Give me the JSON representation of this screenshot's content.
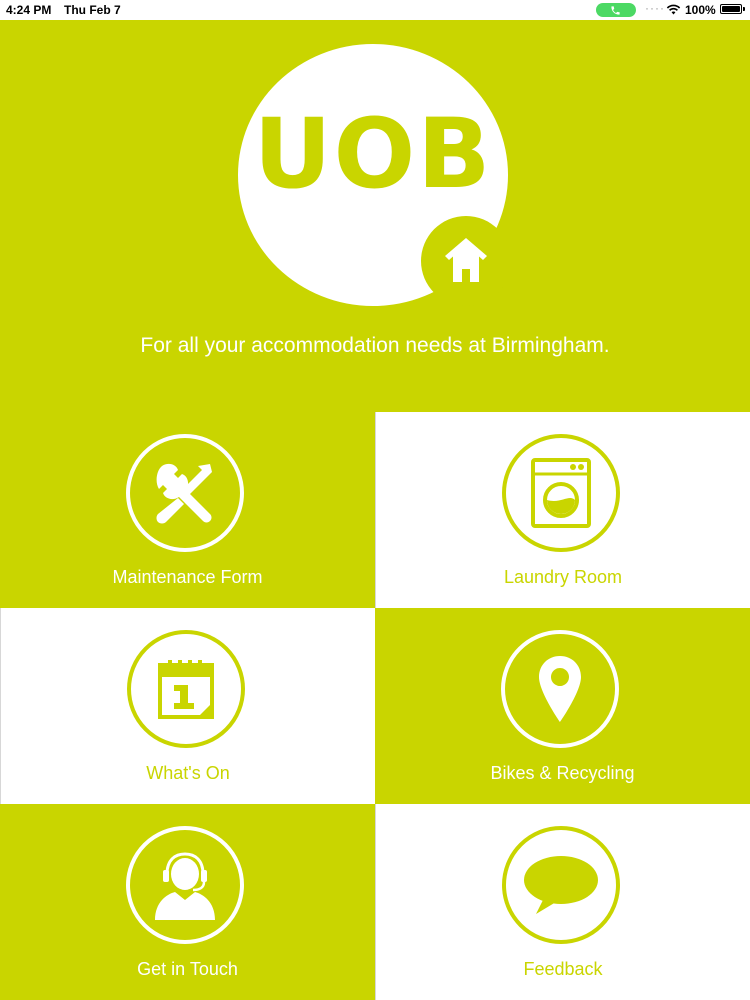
{
  "status_bar": {
    "time": "4:24 PM",
    "date": "Thu Feb 7",
    "battery": "100%",
    "icons": [
      "phone-call-icon",
      "wifi-icon",
      "battery-icon"
    ]
  },
  "header": {
    "logo_text": "UOB",
    "tagline": "For all your accommodation needs at Birmingham.",
    "icon": "house-icon"
  },
  "colors": {
    "brand": "#c9d500",
    "background": "#ffffff",
    "text_on_brand": "#ffffff"
  },
  "menu": [
    {
      "label": "Maintenance Form",
      "icon": "tools-icon"
    },
    {
      "label": "Laundry Room",
      "icon": "washing-machine-icon"
    },
    {
      "label": "What's On",
      "icon": "calendar-icon"
    },
    {
      "label": "Bikes & Recycling",
      "icon": "location-pin-icon"
    },
    {
      "label": "Get in Touch",
      "icon": "headset-person-icon"
    },
    {
      "label": "Feedback",
      "icon": "speech-bubble-icon"
    }
  ]
}
